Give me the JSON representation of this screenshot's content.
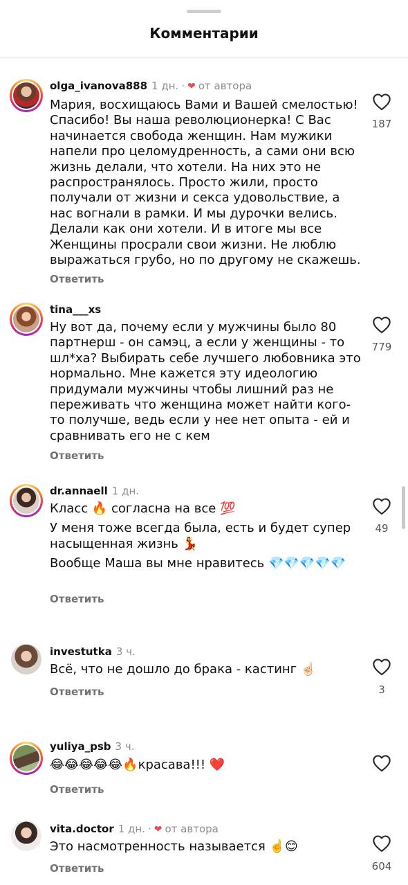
{
  "header": {
    "title": "Комментарии"
  },
  "colors": {
    "accent_heart": "#ed4956",
    "muted": "#8e8e8e"
  },
  "comments": [
    {
      "username": "olga_ivanova888",
      "time": "1 дн.",
      "dot": "·",
      "author_like": "от автора",
      "lines": [
        "Мария, восхищаюсь Вами и Вашей смелостью! Спасибо! Вы наша революционерка! С Вас начинается свобода женщин. Нам мужики напели про целомудренность, а сами они всю жизнь делали, что хотели. На них это не распространялось. Просто жили, просто получали от жизни и секса удовольствие, а нас вогнали в рамки. И мы дурочки велись. Делали как они хотели. И в итоге мы все Женщины просрали свои жизни. Не люблю выражаться грубо, но по другому не скажешь."
      ],
      "reply": "Ответить",
      "likes": "187"
    },
    {
      "username": "tina___xs",
      "lines": [
        "Ну вот да, почему если у мужчины было 80 партнерш - он самэц, а если у женщины - то шл*ха? Выбирать себе лучшего любовника это нормально. Мне кажется эту идеологию придумали мужчины чтобы лишний раз не переживать что женщина может найти кого-то получше, ведь если у нее нет опыта - ей и сравнивать его не с кем"
      ],
      "reply": "Ответить",
      "likes": "779"
    },
    {
      "username": "dr.annaell",
      "time": "1 дн.",
      "lines": [
        "Класс 🔥 согласна на все 💯",
        "У меня тоже всегда была, есть и будет супер насыщенная жизнь 💃",
        "Вообще Маша вы мне нравитесь 💎💎💎💎💎"
      ],
      "reply": "Ответить",
      "likes": "49"
    },
    {
      "username": "investutka",
      "time": "3 ч.",
      "lines": [
        "Всё, что не дошло до брака - кастинг ☝🏻"
      ],
      "reply": "Ответить",
      "likes": "3"
    },
    {
      "username": "yuliya_psb",
      "time": "3 ч.",
      "lines": [
        "😂😂😂😂😂🔥красава!!! ❤️"
      ],
      "reply": "Ответить"
    },
    {
      "username": "vita.doctor",
      "time": "1 дн.",
      "dot": "·",
      "author_like": "от автора",
      "lines": [
        "Это насмотренность называется ☝️😊"
      ],
      "reply": "Ответить",
      "likes": "604"
    }
  ],
  "icons": {
    "like": "heart-outline-icon",
    "author_like": "heart-filled-icon"
  }
}
